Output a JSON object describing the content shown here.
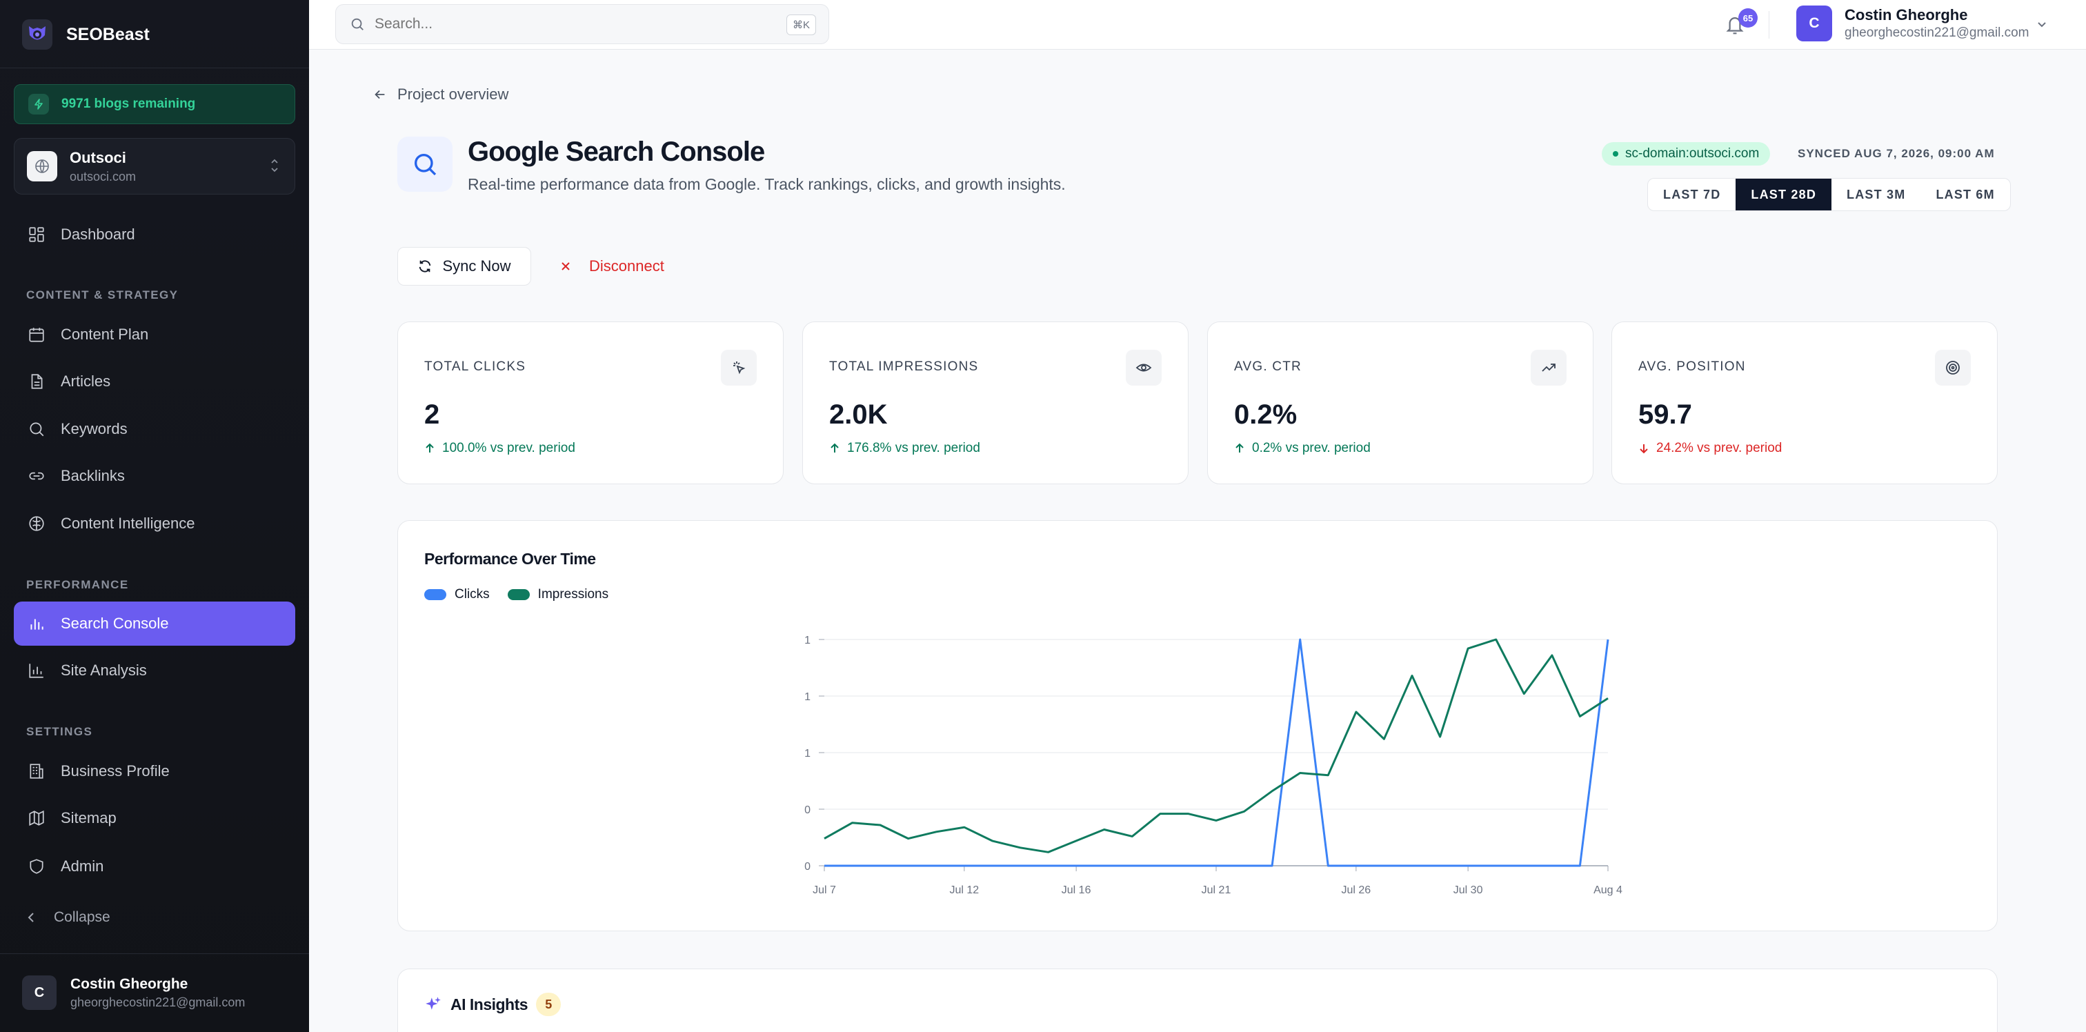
{
  "app": {
    "name": "SEOBeast"
  },
  "credits": {
    "text": "9971 blogs remaining"
  },
  "project": {
    "name": "Outsoci",
    "domain": "outsoci.com"
  },
  "sidebar": {
    "dashboard": "Dashboard",
    "sections": {
      "content": "CONTENT & STRATEGY",
      "performance": "PERFORMANCE",
      "settings": "SETTINGS"
    },
    "items": {
      "content_plan": "Content Plan",
      "articles": "Articles",
      "keywords": "Keywords",
      "backlinks": "Backlinks",
      "content_intelligence": "Content Intelligence",
      "search_console": "Search Console",
      "site_analysis": "Site Analysis",
      "business_profile": "Business Profile",
      "sitemap": "Sitemap",
      "admin": "Admin"
    },
    "collapse": "Collapse",
    "user": {
      "initial": "C",
      "name": "Costin Gheorghe",
      "email": "gheorghecostin221@gmail.com"
    }
  },
  "topbar": {
    "search_placeholder": "Search...",
    "search_shortcut": "⌘K",
    "notifications_count": "65",
    "user": {
      "initial": "C",
      "name": "Costin Gheorghe",
      "email": "gheorghecostin221@gmail.com"
    }
  },
  "page": {
    "back_label": "Project overview",
    "title": "Google Search Console",
    "subtitle": "Real-time performance data from Google. Track rankings, clicks, and growth insights.",
    "domain_badge": "sc-domain:outsoci.com",
    "synced": "SYNCED AUG 7, 2026, 09:00 AM",
    "ranges": [
      "LAST 7D",
      "LAST 28D",
      "LAST 3M",
      "LAST 6M"
    ],
    "active_range": "LAST 28D",
    "sync_button": "Sync Now",
    "disconnect_button": "Disconnect"
  },
  "metrics": [
    {
      "label": "TOTAL CLICKS",
      "value": "2",
      "delta": "100.0% vs prev. period",
      "direction": "up",
      "icon": "cursor-click-icon"
    },
    {
      "label": "TOTAL IMPRESSIONS",
      "value": "2.0K",
      "delta": "176.8% vs prev. period",
      "direction": "up",
      "icon": "eye-icon"
    },
    {
      "label": "AVG. CTR",
      "value": "0.2%",
      "delta": "0.2% vs prev. period",
      "direction": "up",
      "icon": "trending-up-icon"
    },
    {
      "label": "AVG. POSITION",
      "value": "59.7",
      "delta": "24.2% vs prev. period",
      "direction": "down",
      "icon": "target-icon"
    }
  ],
  "performance": {
    "title": "Performance Over Time",
    "legend": [
      "Clicks",
      "Impressions"
    ]
  },
  "chart_data": {
    "type": "line",
    "title": "Performance Over Time",
    "xlabel": "",
    "ylabel": "",
    "x_ticks": [
      "Jul 7",
      "Jul 12",
      "Jul 16",
      "Jul 21",
      "Jul 26",
      "Jul 30",
      "Aug 4"
    ],
    "y_ticks": [
      "0",
      "0",
      "1",
      "1",
      "1"
    ],
    "ylim": [
      0,
      1
    ],
    "grid": true,
    "legend_position": "top-left",
    "x": [
      "Jul 7",
      "Jul 8",
      "Jul 9",
      "Jul 10",
      "Jul 11",
      "Jul 12",
      "Jul 13",
      "Jul 14",
      "Jul 15",
      "Jul 16",
      "Jul 17",
      "Jul 18",
      "Jul 19",
      "Jul 20",
      "Jul 21",
      "Jul 22",
      "Jul 23",
      "Jul 24",
      "Jul 25",
      "Jul 26",
      "Jul 27",
      "Jul 28",
      "Jul 29",
      "Jul 30",
      "Jul 31",
      "Aug 1",
      "Aug 2",
      "Aug 3",
      "Aug 4"
    ],
    "series": [
      {
        "name": "Clicks",
        "color": "#3b82f6",
        "values": [
          0,
          0,
          0,
          0,
          0,
          0,
          0,
          0,
          0,
          0,
          0,
          0,
          0,
          0,
          0,
          0,
          0,
          1,
          0,
          0,
          0,
          0,
          0,
          0,
          0,
          0,
          0,
          0,
          1
        ]
      },
      {
        "name": "Impressions",
        "color": "#0f7b5f",
        "values": [
          0.12,
          0.19,
          0.18,
          0.12,
          0.15,
          0.17,
          0.11,
          0.08,
          0.06,
          0.11,
          0.16,
          0.13,
          0.23,
          0.23,
          0.2,
          0.24,
          0.33,
          0.41,
          0.4,
          0.68,
          0.56,
          0.84,
          0.57,
          0.96,
          1.0,
          0.76,
          0.93,
          0.66,
          0.74
        ]
      }
    ]
  },
  "ai": {
    "title": "AI Insights",
    "count": "5"
  }
}
